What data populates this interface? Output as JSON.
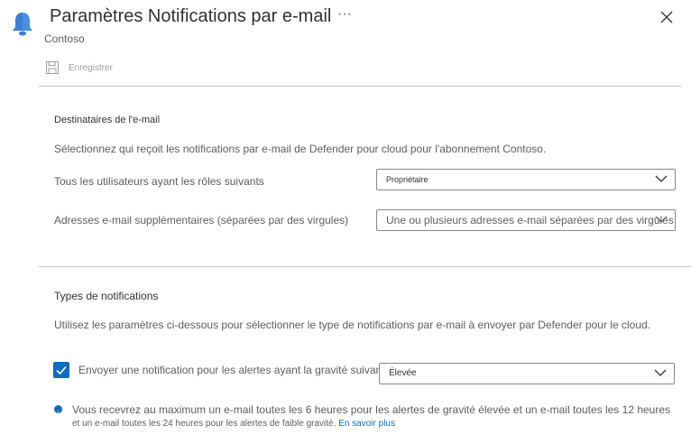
{
  "header": {
    "title": "Paramètres Notifications par e-mail",
    "subtitle": "Contoso",
    "more_label": "···"
  },
  "toolbar": {
    "save_label": "Enregistrer"
  },
  "recipients": {
    "section_title": "Destinataires de l'e-mail",
    "description": "Sélectionnez qui reçoit les notifications par e-mail de Defender pour cloud pour l'abonnement Contoso.",
    "roles_label": "Tous les utilisateurs ayant les rôles suivants",
    "roles_value": "Propriétaire",
    "emails_label": "Adresses e-mail supplémentaires (séparées par des virgules)",
    "emails_placeholder": "Une ou plusieurs adresses e-mail séparées par des virgules"
  },
  "notification_types": {
    "section_title": "Types de notifications",
    "description": "Utilisez les paramètres ci-dessous pour sélectionner le type de notifications par e-mail à envoyer par Defender pour le cloud.",
    "alert_checkbox_label": "Envoyer une notification pour les alertes ayant la gravité suivante (ou supérieure) :",
    "alert_checked": true,
    "severity_value": "Élevée",
    "info_line1": "Vous recevrez au maximum un e-mail toutes les 6 heures pour les alertes de gravité élevée et un e-mail toutes les 12 heures",
    "info_line2": "et un e-mail toutes les 24 heures pour les alertes de faible gravité.",
    "learn_more": "En savoir plus"
  },
  "colors": {
    "accent": "#0f6cbd",
    "text": "#323130",
    "muted": "#605e5c",
    "border": "#8a8886"
  },
  "icons": {
    "header": "bell-icon",
    "save": "save-icon",
    "close": "close-icon",
    "info": "info-icon",
    "check": "checkmark-icon",
    "dropdown": "chevron-down-icon"
  }
}
